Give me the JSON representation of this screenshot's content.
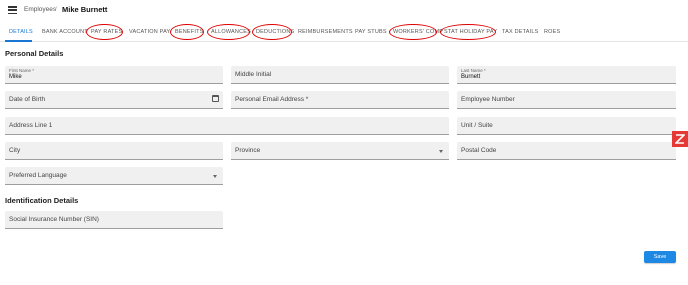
{
  "header": {
    "breadcrumb_root": "Employees",
    "breadcrumb_separator": "/",
    "breadcrumb_current": "Mike Burnett"
  },
  "tabs": [
    {
      "label": "DETAILS",
      "active": true
    },
    {
      "label": "BANK ACCOUNT"
    },
    {
      "label": "PAY RATES",
      "circled": true
    },
    {
      "label": "VACATION PAY"
    },
    {
      "label": "BENEFITS",
      "circled": true
    },
    {
      "label": "ALLOWANCES",
      "circled": true
    },
    {
      "label": "DEDUCTIONS",
      "circled": true
    },
    {
      "label": "REIMBURSEMENTS"
    },
    {
      "label": "PAY STUBS"
    },
    {
      "label": "WORKERS' COMP",
      "circled": true
    },
    {
      "label": "STAT HOLIDAY PAY",
      "circled": true
    },
    {
      "label": "TAX DETAILS"
    },
    {
      "label": "ROES"
    }
  ],
  "colors": {
    "accent": "#1976d2",
    "annotation": "#e00000",
    "save_button": "#1e88e5",
    "floating_button": "#e53935"
  },
  "personal": {
    "title": "Personal Details",
    "first_name": {
      "label": "First Name *",
      "value": "Mike"
    },
    "middle_initial": {
      "placeholder": "Middle Initial"
    },
    "last_name": {
      "label": "Last Name *",
      "value": "Burnett"
    },
    "date_of_birth": {
      "placeholder": "Date of Birth",
      "icon": "calendar-icon"
    },
    "email": {
      "placeholder": "Personal Email Address *"
    },
    "employee_number": {
      "placeholder": "Employee Number"
    },
    "address_line_1": {
      "placeholder": "Address Line 1"
    },
    "unit_suite": {
      "placeholder": "Unit / Suite"
    },
    "city": {
      "placeholder": "City"
    },
    "province": {
      "placeholder": "Province"
    },
    "postal_code": {
      "placeholder": "Postal Code"
    },
    "preferred_language": {
      "placeholder": "Preferred Language"
    }
  },
  "identification": {
    "title": "Identification Details",
    "sin": {
      "placeholder": "Social Insurance Number (SIN)"
    }
  },
  "actions": {
    "save_label": "Save"
  }
}
